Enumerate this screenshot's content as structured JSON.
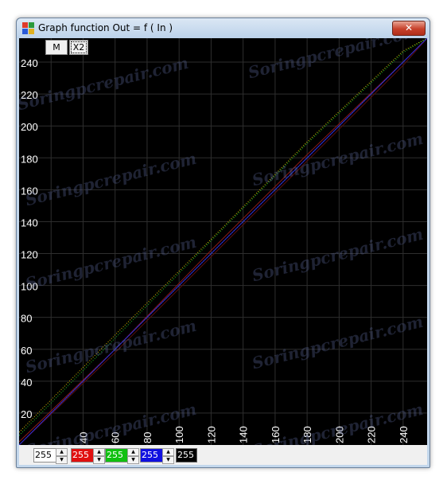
{
  "window": {
    "title": "Graph function Out = f ( In )",
    "close_label": "✕"
  },
  "toolbar": {
    "m_label": "M",
    "x2_label": "X2"
  },
  "chart_data": {
    "type": "line",
    "title": "",
    "xlabel": "",
    "ylabel": "",
    "xlim": [
      0,
      255
    ],
    "ylim": [
      0,
      255
    ],
    "x_ticks": [
      "40",
      "60",
      "80",
      "100",
      "120",
      "140",
      "160",
      "180",
      "200",
      "220",
      "240"
    ],
    "y_ticks": [
      "240",
      "220",
      "200",
      "180",
      "160",
      "140",
      "120",
      "100",
      "80",
      "60",
      "40",
      "20"
    ],
    "grid": true,
    "background": "#000000",
    "series": [
      {
        "color": "#c8c8c8",
        "style": "dotted",
        "x": [
          0,
          255
        ],
        "y": [
          0,
          255
        ]
      },
      {
        "color": "#d2c000",
        "style": "dotted",
        "x": [
          0,
          60,
          120,
          180,
          240,
          255
        ],
        "y": [
          8,
          69,
          129,
          190,
          247,
          255
        ]
      },
      {
        "color": "#20c020",
        "style": "dotted",
        "x": [
          0,
          60,
          120,
          180,
          240,
          255
        ],
        "y": [
          6,
          67,
          128,
          189,
          246,
          255
        ]
      },
      {
        "color": "#8c1a1a",
        "style": "solid",
        "x": [
          0,
          60,
          120,
          180,
          240,
          255
        ],
        "y": [
          2,
          60,
          122,
          182,
          240,
          255
        ]
      },
      {
        "color": "#5a0e0e",
        "style": "solid",
        "x": [
          0,
          60,
          120,
          180,
          240,
          255
        ],
        "y": [
          0,
          58,
          118,
          178,
          238,
          255
        ]
      },
      {
        "color": "#2a2ad8",
        "style": "solid",
        "x": [
          0,
          255
        ],
        "y": [
          0,
          255
        ]
      }
    ]
  },
  "controls": [
    {
      "name": "master",
      "value": "255",
      "color": "#ffffff",
      "text_color": "#000000"
    },
    {
      "name": "red",
      "value": "255",
      "color": "#e01010",
      "text_color": "#ffffff"
    },
    {
      "name": "green",
      "value": "255",
      "color": "#10c010",
      "text_color": "#ffffff"
    },
    {
      "name": "blue",
      "value": "255",
      "color": "#1010e0",
      "text_color": "#ffffff"
    },
    {
      "name": "black",
      "value": "255",
      "color": "#000000",
      "text_color": "#ffffff"
    }
  ],
  "watermark": "Soringpcrepair.com"
}
